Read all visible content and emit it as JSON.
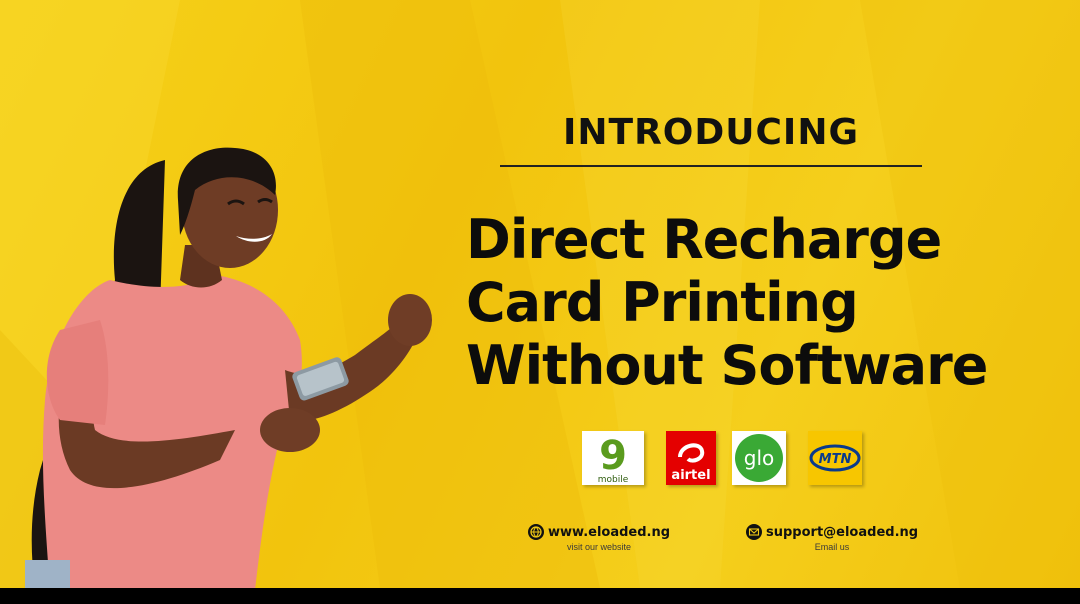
{
  "headline": {
    "intro": "INTRODUCING",
    "title_lines": [
      "Direct Recharge",
      "Card Printing",
      "Without Software"
    ]
  },
  "logos": {
    "nine_mobile": {
      "big": "9",
      "small": "mobile"
    },
    "airtel": "airtel",
    "glo": "glo",
    "mtn": "MTN"
  },
  "contact": {
    "website": {
      "text": "www.eloaded.ng",
      "caption": "visit our website",
      "icon": "globe-icon"
    },
    "email": {
      "text": "support@eloaded.ng",
      "caption": "Email us",
      "icon": "mail-icon"
    }
  },
  "colors": {
    "background": "#f4cb15",
    "text": "#0c0c0c",
    "airtel_red": "#e40000",
    "glo_green": "#3aa935",
    "nine_green": "#5a9b1e",
    "mtn_yellow": "#f7c600",
    "mtn_blue": "#0a3a8c"
  }
}
